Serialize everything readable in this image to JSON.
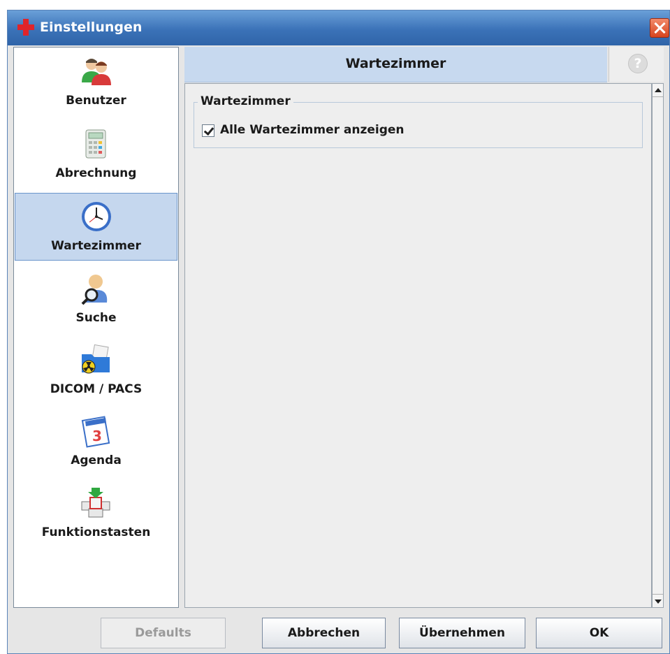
{
  "window": {
    "title": "Einstellungen"
  },
  "sidebar": {
    "items": [
      {
        "label": "Benutzer",
        "icon": "users-icon"
      },
      {
        "label": "Abrechnung",
        "icon": "calculator-icon"
      },
      {
        "label": "Wartezimmer",
        "icon": "clock-icon",
        "selected": true
      },
      {
        "label": "Suche",
        "icon": "person-search-icon"
      },
      {
        "label": "DICOM / PACS",
        "icon": "radiation-folder-icon"
      },
      {
        "label": "Agenda",
        "icon": "calendar-icon"
      },
      {
        "label": "Funktionstasten",
        "icon": "keyboard-keys-icon"
      }
    ]
  },
  "panel": {
    "title": "Wartezimmer",
    "help": "?",
    "group_title": "Wartezimmer",
    "checkbox": {
      "label": "Alle Wartezimmer anzeigen",
      "checked": true
    }
  },
  "buttons": {
    "defaults": "Defaults",
    "cancel": "Abbrechen",
    "apply": "Übernehmen",
    "ok": "OK"
  },
  "colors": {
    "titlebar": "#3b72b8",
    "selection": "#c5d7ee",
    "header": "#c7d9ef",
    "close": "#d8441e"
  }
}
